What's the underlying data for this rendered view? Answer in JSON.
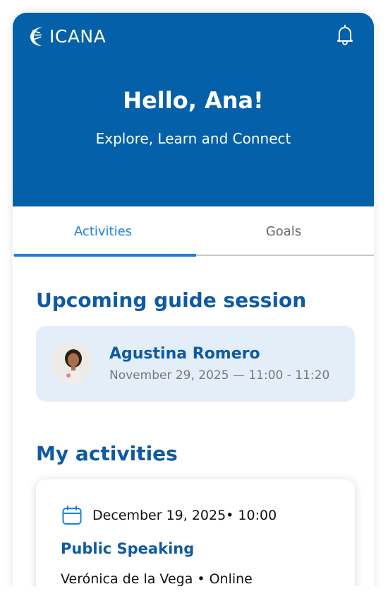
{
  "header": {
    "logo_text": "ICANA",
    "greeting": "Hello, Ana!",
    "subtitle": "Explore, Learn and Connect",
    "bell_icon": "bell-icon",
    "background": "#0460a9"
  },
  "tabs": [
    {
      "label": "Activities",
      "active": true
    },
    {
      "label": "Goals",
      "active": false
    }
  ],
  "upcoming": {
    "title": "Upcoming guide session",
    "guide_name": "Agustina Romero",
    "date_time": "November 29, 2025 — 11:00 - 11:20"
  },
  "my_activities": {
    "title": "My activities",
    "items": [
      {
        "date": "December 19, 2025• 10:00",
        "title": "Public Speaking",
        "host": "Verónica de la Vega",
        "mode": "Online",
        "icon": "calendar-icon"
      }
    ]
  },
  "colors": {
    "primary": "#0460a9",
    "accent": "#1d7fe0",
    "heading": "#0f5aa3",
    "card_bg": "#e4eef9"
  }
}
